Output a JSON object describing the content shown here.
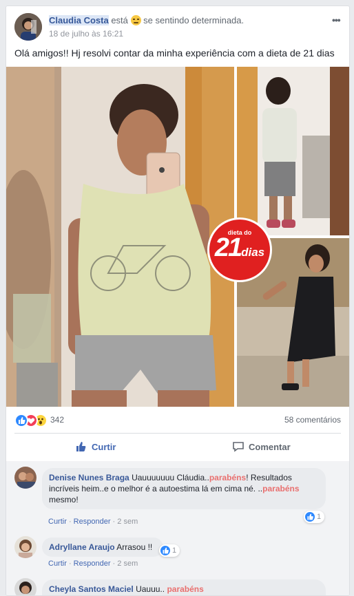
{
  "post": {
    "author": "Claudia Costa",
    "status_prefix": "está",
    "feeling": "se sentindo determinada.",
    "timestamp": "18 de julho às 16:21",
    "more_label": "•••",
    "text": "Olá amigos!! Hj resolvi contar da minha experiência com a dieta de 21 dias",
    "badge_top": "dieta do",
    "badge_number": "21",
    "badge_word": "dias"
  },
  "stats": {
    "reaction_count": "342",
    "comment_count": "58 comentários"
  },
  "actions": {
    "like": "Curtir",
    "comment": "Comentar"
  },
  "comments": [
    {
      "name": "Denise Nunes Braga",
      "text_1": "Uauuuuuuu Cláudia..",
      "hl_1": "parabéns",
      "text_2": "! Resultados incríveis heim..e o melhor é a autoestima lá em cima né. ..",
      "hl_2": "parabéns",
      "text_3": " mesmo!",
      "like": "Curtir",
      "reply": "Responder",
      "time": "2 sem",
      "likes": "1"
    },
    {
      "name": "Adryllane Araujo",
      "text_1": "Arrasou !!",
      "like": "Curtir",
      "reply": "Responder",
      "time": "2 sem",
      "likes": "1"
    },
    {
      "name": "Cheyla Santos Maciel",
      "text_1": "Uauuu..",
      "hl_1": "parabéns"
    }
  ],
  "colors": {
    "link": "#365899",
    "accent": "#4267b2",
    "highlight": "#e9706f",
    "badge_red": "#e02020"
  }
}
